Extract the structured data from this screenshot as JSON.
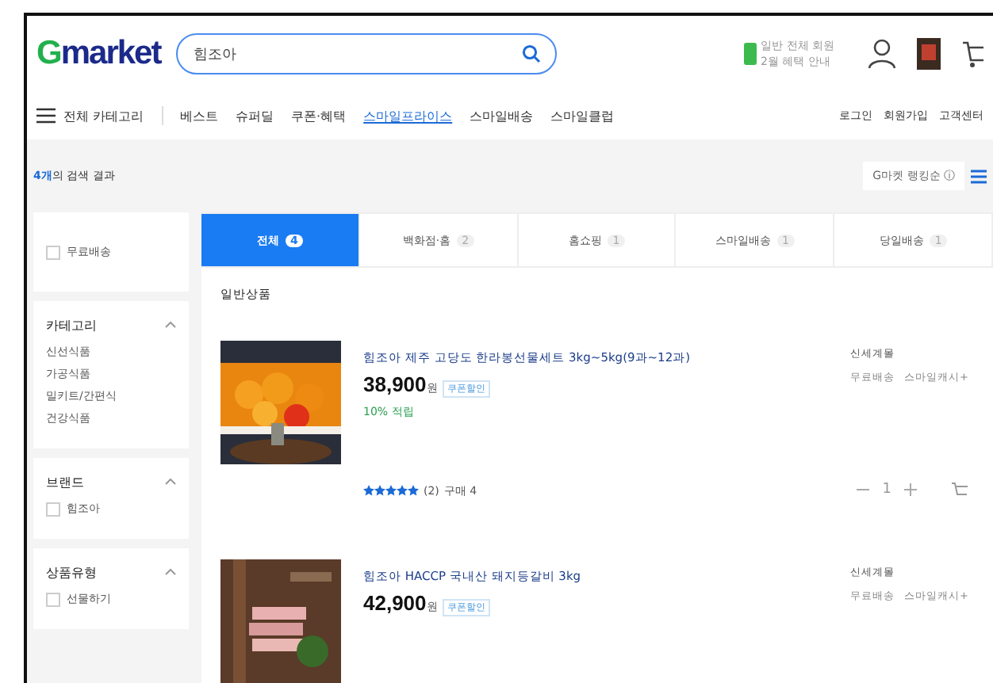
{
  "header": {
    "logo": "Gmarket",
    "search": {
      "value": "힘조아"
    },
    "promo": [
      "일반 전체 회원",
      "2월 혜택 안내"
    ],
    "nav": [
      "베스트",
      "슈퍼딜",
      "쿠폰·혜택",
      "스마일프라이스",
      "스마일배송",
      "스마일클럽"
    ],
    "all_categories": "전체 카테고리",
    "links": [
      "로그인",
      "회원가입",
      "고객센터"
    ]
  },
  "result_summary": {
    "count": "4개",
    "text": "의 검색 결과"
  },
  "sort": "G마켓 랭킹순 ⓘ",
  "sidebar": {
    "free_shipping": {
      "label": "무료배송",
      "checked": false
    },
    "sections": [
      {
        "title": "카테고리",
        "expanded": true,
        "kind": "links",
        "items": [
          {
            "label": "신선식품",
            "checked": false
          },
          {
            "label": "가공식품",
            "checked": false
          },
          {
            "label": "밀키트/간편식",
            "checked": false
          },
          {
            "label": "건강식품",
            "checked": false
          }
        ]
      },
      {
        "title": "브랜드",
        "expanded": true,
        "kind": "checks",
        "items": [
          {
            "label": "힘조아",
            "checked": false
          }
        ]
      },
      {
        "title": "상품유형",
        "expanded": true,
        "kind": "checks",
        "items": [
          {
            "label": "선물하기",
            "checked": false
          }
        ]
      }
    ]
  },
  "tabs": [
    {
      "label": "전체",
      "count": "4",
      "selected": true
    },
    {
      "label": "백화점·홈",
      "count": "2",
      "selected": false
    },
    {
      "label": "홈쇼핑",
      "count": "1",
      "selected": false
    },
    {
      "label": "스마일배송",
      "count": "1",
      "selected": false
    },
    {
      "label": "당일배송",
      "count": "1",
      "selected": false
    }
  ],
  "section_title": "일반상품",
  "products": [
    {
      "title": "힘조아 제주 고당도 한라봉선물세트 3kg~5kg(9과~12과)",
      "price": "38,900",
      "unit": "원",
      "badge": "쿠폰할인",
      "reward": "10% 적립",
      "stars": 5,
      "reviews": "(2)",
      "buyers": "구매 4",
      "seller": "신세계몰",
      "tags": [
        "무료배송",
        "스마일캐시+"
      ],
      "quantity": "1",
      "kind": "picture"
    },
    {
      "title": "힘조아 HACCP 국내산 돼지등갈비 3kg",
      "price": "42,900",
      "unit": "원",
      "badge": "쿠폰할인",
      "seller": "신세계몰",
      "tags": [
        "무료배송",
        "스마일캐시+"
      ],
      "kind": "picture"
    }
  ]
}
